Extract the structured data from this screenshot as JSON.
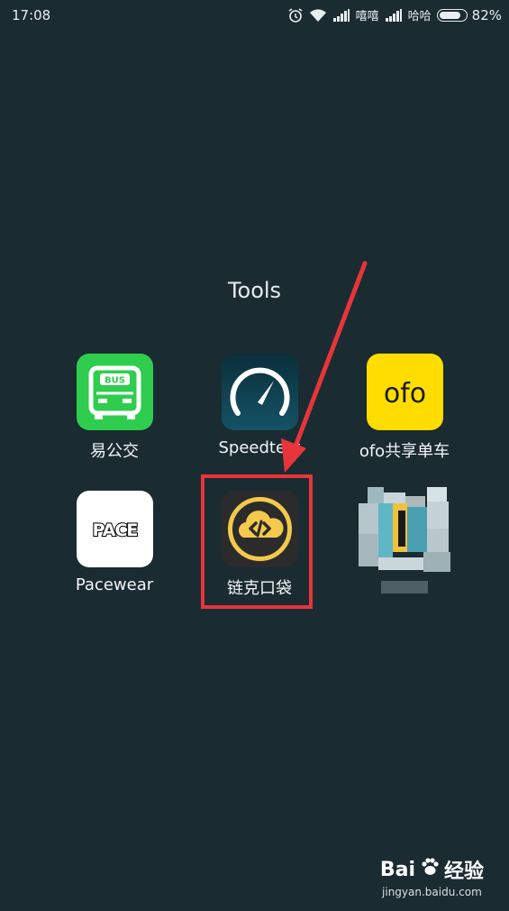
{
  "status_bar": {
    "time": "17:08",
    "carrier1": "嘻嘻",
    "carrier2": "哈哈",
    "battery_percent": "82%",
    "battery_level": 0.82
  },
  "folder": {
    "title": "Tools",
    "apps": [
      {
        "label": "易公交",
        "icon": "bus-icon",
        "icon_text": "BUS"
      },
      {
        "label": "Speedtest",
        "icon": "speedometer-icon"
      },
      {
        "label": "ofo共享单车",
        "icon": "ofo-icon",
        "icon_text": "ofo"
      },
      {
        "label": "Pacewear",
        "icon": "pace-icon",
        "icon_text": "PACE"
      },
      {
        "label": "链克口袋",
        "icon": "chain-cloud-icon"
      },
      {
        "label": "",
        "icon": "blurred-app-icon"
      }
    ]
  },
  "watermark": {
    "brand_left": "Bai",
    "brand_right": "经验",
    "url": "jingyan.baidu.com"
  },
  "colors": {
    "background": "#1b2b32",
    "highlight": "#e7353a",
    "bus_green": "#2fcd4d",
    "ofo_yellow": "#ffdd00",
    "chain_gold": "#f2c94c"
  }
}
